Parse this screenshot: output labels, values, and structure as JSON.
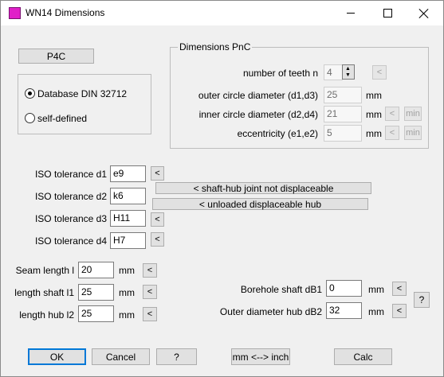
{
  "window": {
    "title": "WN14 Dimensions",
    "icon": "app-icon",
    "accent": "#0078d7"
  },
  "p4c_button": "P4C",
  "standard": {
    "options": [
      "Database DIN 32712",
      "self-defined"
    ],
    "selected": "Database DIN 32712"
  },
  "dims": {
    "title": "Dimensions PnC",
    "teeth_label": "number of teeth n",
    "teeth_value": "4",
    "outer_label": "outer circle diameter (d1,d3)",
    "outer_value": "25",
    "inner_label": "inner circle diameter (d2,d4)",
    "inner_value": "21",
    "ecc_label": "eccentricity (e1,e2)",
    "ecc_value": "5",
    "unit": "mm",
    "arrow": "<",
    "min": "min"
  },
  "iso": {
    "d1_label": "ISO tolerance d1",
    "d1_value": "e9",
    "d2_label": "ISO tolerance d2",
    "d2_value": "k6",
    "d3_label": "ISO tolerance d3",
    "d3_value": "H11",
    "d4_label": "ISO tolerance d4",
    "d4_value": "H7",
    "shaft_hub_button": "<  shaft-hub joint not displaceable",
    "unloaded_button": "<  unloaded displaceable hub"
  },
  "lengths": {
    "seam_label": "Seam length l",
    "seam_value": "20",
    "shaft_label": "length shaft l1",
    "shaft_value": "25",
    "hub_label": "length hub l2",
    "hub_value": "25",
    "unit": "mm"
  },
  "bore": {
    "shaft_label": "Borehole shaft dB1",
    "shaft_value": "0",
    "hub_label": "Outer diameter hub dB2",
    "hub_value": "32",
    "unit": "mm",
    "help": "?"
  },
  "footer": {
    "ok": "OK",
    "cancel": "Cancel",
    "help": "?",
    "units": "mm <--> inch",
    "calc": "Calc"
  }
}
